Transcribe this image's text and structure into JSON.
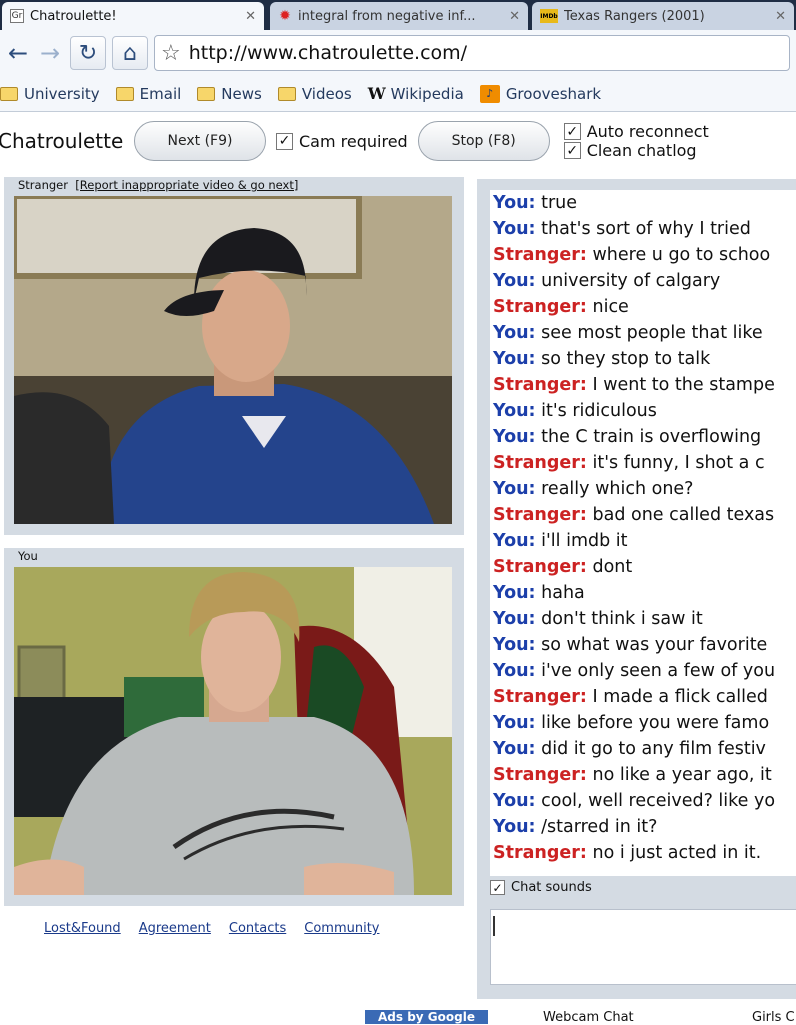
{
  "colors": {
    "you": "#1c3faa",
    "stranger": "#cc2222",
    "panel": "#d4dbe3",
    "link": "#1a3a8a"
  },
  "tabs": [
    {
      "favicon": "Gr",
      "title": "Chatroulette!"
    },
    {
      "favicon": "gear-icon",
      "title": "integral from negative inf..."
    },
    {
      "favicon": "IMDb",
      "title": "Texas Rangers (2001)"
    }
  ],
  "omnibox": {
    "url": "http://www.chatroulette.com/"
  },
  "bookmarks": [
    {
      "icon": "folder-icon",
      "label": "University"
    },
    {
      "icon": "folder-icon",
      "label": "Email"
    },
    {
      "icon": "folder-icon",
      "label": "News"
    },
    {
      "icon": "folder-icon",
      "label": "Videos"
    },
    {
      "icon": "wikipedia-icon",
      "label": "Wikipedia"
    },
    {
      "icon": "grooveshark-icon",
      "label": "Grooveshark"
    }
  ],
  "app": {
    "brand": "Chatroulette",
    "next_label": "Next (F9)",
    "cam_required_label": "Cam required",
    "stop_label": "Stop (F8)",
    "auto_reconnect_label": "Auto reconnect",
    "clean_chatlog_label": "Clean chatlog"
  },
  "stranger_panel": {
    "label": "Stranger",
    "report_label": "[Report inappropriate video & go next]"
  },
  "you_panel": {
    "label": "You"
  },
  "chat": [
    {
      "who": "You:",
      "text": "true"
    },
    {
      "who": "You:",
      "text": "that's sort of why I tried"
    },
    {
      "who": "Stranger:",
      "text": "where u go to schoo"
    },
    {
      "who": "You:",
      "text": "university of calgary"
    },
    {
      "who": "Stranger:",
      "text": "nice"
    },
    {
      "who": "You:",
      "text": "see most people that like"
    },
    {
      "who": "You:",
      "text": "so they stop to talk"
    },
    {
      "who": "Stranger:",
      "text": "I went to the stampe"
    },
    {
      "who": "You:",
      "text": "it's ridiculous"
    },
    {
      "who": "You:",
      "text": "the C train is overflowing"
    },
    {
      "who": "Stranger:",
      "text": "it's funny, I shot a c"
    },
    {
      "who": "You:",
      "text": "really which one?"
    },
    {
      "who": "Stranger:",
      "text": "bad one called texas"
    },
    {
      "who": "You:",
      "text": "i'll imdb it"
    },
    {
      "who": "Stranger:",
      "text": "dont"
    },
    {
      "who": "You:",
      "text": "haha"
    },
    {
      "who": "You:",
      "text": "don't think i saw it"
    },
    {
      "who": "You:",
      "text": "so what was your favorite"
    },
    {
      "who": "You:",
      "text": "i've only seen a few of you"
    },
    {
      "who": "Stranger:",
      "text": "I made a flick called"
    },
    {
      "who": "You:",
      "text": "like before you were famo"
    },
    {
      "who": "You:",
      "text": "did it go to any film festiv"
    },
    {
      "who": "Stranger:",
      "text": "no like a year ago, it"
    },
    {
      "who": "You:",
      "text": "cool, well received? like yo"
    },
    {
      "who": "You:",
      "text": "/starred in it?"
    },
    {
      "who": "Stranger:",
      "text": "no i just acted in it."
    }
  ],
  "chat_sounds_label": "Chat sounds",
  "footer_links": [
    "Lost&Found",
    "Agreement",
    "Contacts",
    "Community"
  ],
  "bottom": {
    "ads_label": "Ads by Google",
    "link1": "Webcam Chat",
    "link2": "Girls C"
  }
}
